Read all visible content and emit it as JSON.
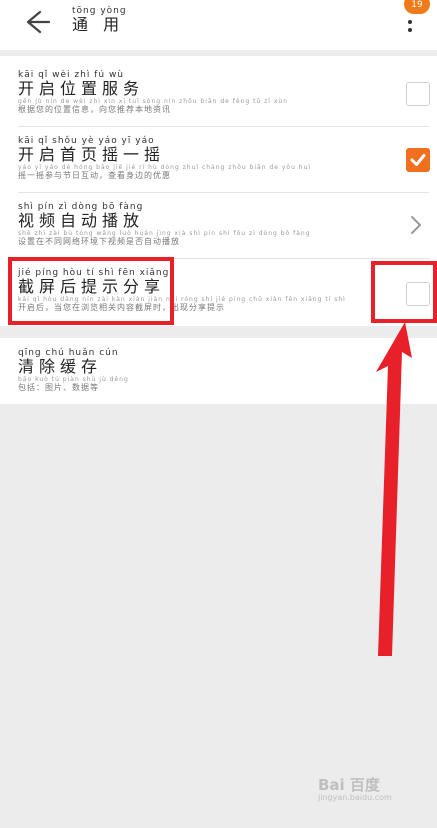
{
  "header": {
    "title_pinyin": "tōng yòng",
    "title": "通 用",
    "badge": "19"
  },
  "settings": [
    {
      "title_pinyin": "kāi qǐ wèi zhì fú wù",
      "title": "开启位置服务",
      "desc_pinyin": "gēn jù nín de wèi zhì xìn xī tuī sòng nín zhōu biān de fēng tǔ zī xùn",
      "desc": "根据您的位置信息，向您推荐本地资讯",
      "control": "checkbox",
      "checked": false
    },
    {
      "title_pinyin": "kāi qǐ shǒu yè yáo yī yáo",
      "title": "开启首页摇一摇",
      "desc_pinyin": "yáo yī yáo dé hóng bāo jiē jié rì hù dòng zhuī cháng zhōu biān de yōu huì",
      "desc": "摇一摇参与节日互动，查看身边的优惠",
      "control": "checkbox",
      "checked": true
    },
    {
      "title_pinyin": "shì pín zì dòng bō fàng",
      "title": "视频自动播放",
      "desc_pinyin": "shè zhì zài bù tóng wǎng luò huán jìng xià shì pín shì fǒu zì dòng bō fàng",
      "desc": "设置在不同网络环境下视频是否自动播放",
      "control": "chevron"
    },
    {
      "title_pinyin": "jié píng hòu tí shì fēn xiǎng",
      "title": "截屏后提示分享",
      "desc_pinyin": "kāi qǐ hòu dāng nín zài kàn xiàn jiàn nèi róng shí jié píng chū xiàn fēn xiǎng tí shì",
      "desc": "开启后，当您在浏览相关内容截屏时，出现分享提示",
      "control": "checkbox",
      "checked": false
    }
  ],
  "cache": {
    "title_pinyin": "qīng chú huǎn cún",
    "title": "清除缓存",
    "desc_pinyin": "bāo kuò tú piàn shù jù děng",
    "desc": "包括：图片、数据等"
  },
  "watermark": {
    "brand": "Bai 百度",
    "sub": "jingyan.baidu.com"
  },
  "colors": {
    "accent": "#f07020",
    "highlight": "#e8202a",
    "background": "#ececec"
  },
  "icons": {
    "back": "arrow-left-icon",
    "more": "vertical-dots-icon",
    "chevron": "chevron-right-icon",
    "check": "checkmark-icon"
  }
}
